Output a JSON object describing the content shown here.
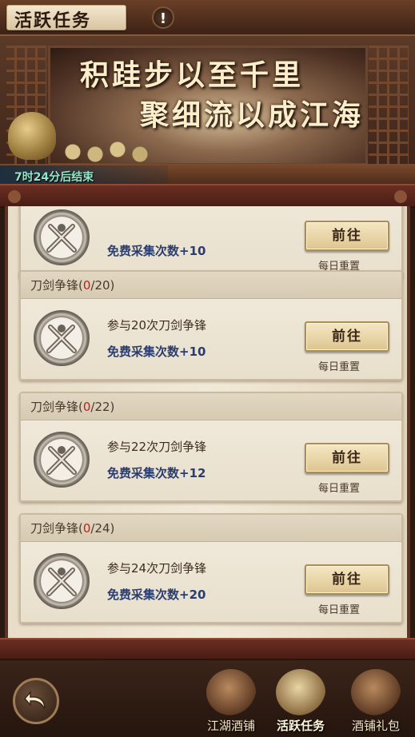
{
  "header": {
    "title": "活跃任务",
    "alert_symbol": "!"
  },
  "banner": {
    "slogan_line1": "积跬步以至千里",
    "slogan_line2": "聚细流以成江海",
    "timer": "7时24分后结束"
  },
  "tasks": [
    {
      "header": "",
      "count": "",
      "target": "",
      "description": "",
      "reward": "免费采集次数+10",
      "button_label": "前往",
      "reset_label": "每日重置",
      "icon": "crossed-swords-icon"
    },
    {
      "header": "刀剑争锋(",
      "count": "0",
      "target": "/20)",
      "description": "参与20次刀剑争锋",
      "reward": "免费采集次数+10",
      "button_label": "前往",
      "reset_label": "每日重置",
      "icon": "crossed-swords-icon"
    },
    {
      "header": "刀剑争锋(",
      "count": "0",
      "target": "/22)",
      "description": "参与22次刀剑争锋",
      "reward": "免费采集次数+12",
      "button_label": "前往",
      "reset_label": "每日重置",
      "icon": "crossed-swords-icon"
    },
    {
      "header": "刀剑争锋(",
      "count": "0",
      "target": "/24)",
      "description": "参与24次刀剑争锋",
      "reward": "免费采集次数+20",
      "button_label": "前往",
      "reset_label": "每日重置",
      "icon": "crossed-swords-icon"
    }
  ],
  "bottom_nav": {
    "back_icon": "back-arrow-icon",
    "items": [
      {
        "label": "江湖酒铺",
        "icon": "wine-jar-icon",
        "active": false
      },
      {
        "label": "活跃任务",
        "icon": "scroll-brush-icon",
        "active": true
      },
      {
        "label": "酒铺礼包",
        "icon": "gift-bag-icon",
        "active": false
      }
    ]
  },
  "colors": {
    "count_red": "#c21f14",
    "reward_blue": "#2a3d6e",
    "timer_green": "#8fe8c9"
  }
}
